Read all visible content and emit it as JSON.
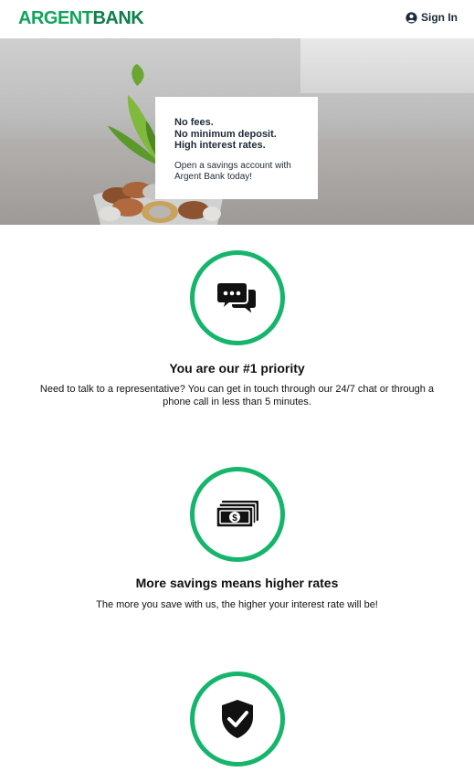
{
  "header": {
    "logo_part1": "ARGENT",
    "logo_part2": "BANK",
    "signin_label": "Sign In"
  },
  "promo": {
    "line1": "No fees.",
    "line2": "No minimum deposit.",
    "line3": "High interest rates.",
    "subtext": "Open a savings account with Argent Bank today!"
  },
  "features": [
    {
      "icon": "chat-icon",
      "title": "You are our #1 priority",
      "description": "Need to talk to a representative? You can get in touch through our 24/7 chat or through a phone call in less than 5 minutes."
    },
    {
      "icon": "money-icon",
      "title": "More savings means higher rates",
      "description": "The more you save with us, the higher your interest rate will be!"
    },
    {
      "icon": "security-shield-icon",
      "title": "",
      "description": ""
    }
  ],
  "colors": {
    "brand_green": "#10a35a",
    "circle_green": "#15b56b"
  }
}
